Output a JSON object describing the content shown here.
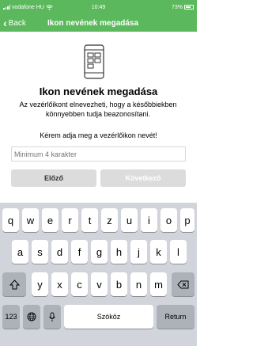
{
  "status_bar": {
    "carrier": "vodafone HU",
    "time": "10:49",
    "battery": "73%"
  },
  "nav": {
    "back_label": "Back",
    "title": "Ikon nevének megadása"
  },
  "main": {
    "heading": "Ikon nevének megadása",
    "description": "Az vezérlőikont elnevezheti, hogy a későbbiekben könnyebben tudja beazonosítani.",
    "prompt": "Kérem adja meg a vezérlőikon nevét!",
    "input_placeholder": "Minimum 4 karakter",
    "input_value": "",
    "prev_button": "Előző",
    "next_button": "Következő"
  },
  "keyboard": {
    "row1": [
      "q",
      "w",
      "e",
      "r",
      "t",
      "z",
      "u",
      "i",
      "o",
      "p"
    ],
    "row2": [
      "a",
      "s",
      "d",
      "f",
      "g",
      "h",
      "j",
      "k",
      "l"
    ],
    "row3": [
      "y",
      "x",
      "c",
      "v",
      "b",
      "n",
      "m"
    ],
    "numbers_key": "123",
    "space_key": "Szóköz",
    "return_key": "Return",
    "shift_icon": "shift-icon",
    "backspace_icon": "backspace-icon",
    "globe_icon": "globe-icon",
    "mic_icon": "microphone-icon"
  },
  "colors": {
    "accent": "#5cb85c",
    "button_bg": "#dcdcdc",
    "keyboard_bg": "#d1d4da",
    "key_dark": "#adb2ba"
  }
}
